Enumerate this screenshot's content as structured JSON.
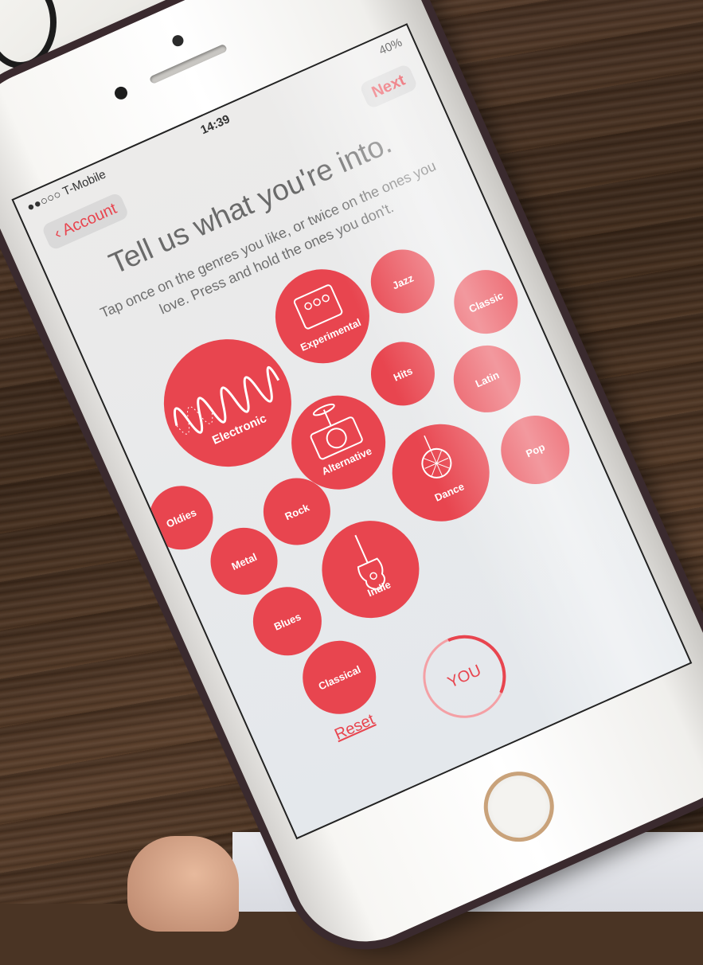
{
  "status_bar": {
    "carrier": "●●○○○ T-Mobile",
    "time": "14:39",
    "battery": "40%"
  },
  "nav": {
    "back_label": "Account",
    "next_label": "Next"
  },
  "header": {
    "title": "Tell us what you're into.",
    "subtitle": "Tap once on the genres you like, or twice on the ones you love. Press and hold the ones you don't."
  },
  "genres": {
    "electronic": "Electronic",
    "experimental": "Experimental",
    "jazz": "Jazz",
    "classic": "Classic",
    "oldies": "Oldies",
    "alternative": "Alternative",
    "hits": "Hits",
    "latin": "Latin",
    "metal": "Metal",
    "rock": "Rock",
    "dance": "Dance",
    "pop": "Pop",
    "blues": "Blues",
    "indie": "Indie",
    "classical": "Classical"
  },
  "you_label": "YOU",
  "reset_label": "Reset",
  "colors": {
    "accent": "#e8454f",
    "ring_light": "#f4a0a5"
  }
}
